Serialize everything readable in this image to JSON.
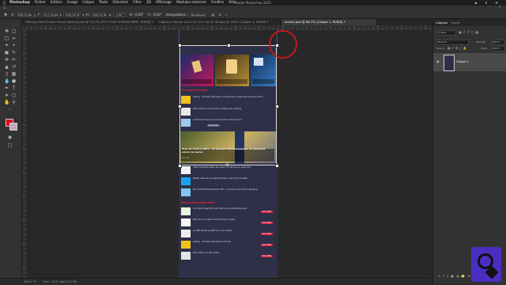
{
  "menubar": {
    "app": "Photoshop",
    "items": [
      "Fichier",
      "Edition",
      "Image",
      "Calque",
      "Texte",
      "Sélection",
      "Filtre",
      "3D",
      "Affichage",
      "Modules externes",
      "Fenêtre",
      "Aide"
    ]
  },
  "window_title": "Adobe Photoshop 2021",
  "options_bar": {
    "x_value": "904,50 px",
    "y_value": "127,00 px",
    "w_value": "100,00 %",
    "h_value": "100,00 %",
    "angle_value": "0,00 °",
    "interpolation_label": "Interpolation :",
    "interpolation_value": "Bicubique"
  },
  "tabs": [
    {
      "label": "Holding Hand Smart Phone Mockup.psd @ 33,3% (PUT YOUR SCREEN HERE, RVB/8) *",
      "active": false
    },
    {
      "label": "Capture d'écran 2021-07-19 à 16.53.58.png @ 100% (Calque 1, RVB/8) *",
      "active": false
    },
    {
      "label": "screen.psd @ 66,7% (Calque 1, RVB/8) *",
      "active": true
    }
  ],
  "panel": {
    "tabs": [
      "Calques",
      "Tracés"
    ],
    "blend_mode": "Normal",
    "opacity_label": "Opacité :",
    "opacity_value": "100 %",
    "lock_label": "Verrou :",
    "fill_label": "Fond :",
    "fill_value": "100 %",
    "layers": [
      {
        "name": "Calque 1",
        "selected": true
      }
    ]
  },
  "status": {
    "zoom": "66,67 %",
    "doc_size": "Doc : 3,52 Mo/3,52 Mo"
  },
  "document": {
    "section1_title": "Derniers articles",
    "articles": [
      "Galaxy : 70 dead high test comment lire le detail des Amazon Prime",
      "Sea divers et un transfert multiple des tuesday",
      "Comment utiliser le nouvel outil de Windows 11"
    ],
    "hero_title": "Tour de France 2021 : 10 dossiers technologiques et comment suivre la course",
    "hero_date": "Il y a 4h",
    "articles2": [
      "Apple présente Apple Pay Later, un service de paiement",
      "Twitter abandonne déjà les Fleets, une fonctionnalité",
      "Microsoft Teams Windows 365 : la solution de cloud computing"
    ],
    "section2_title": "Bons plans high-tech",
    "deals": [
      "Comment regarder Squid Game et le streaming plus",
      "Pack de 2 écouteurs sans fil à prix cassé",
      "Le SSD Samsung 980 Pro à prix réduit",
      "Galaxy : 70 dead high test comment",
      "Echo Show 5 à prix réduit"
    ],
    "deal_badge": "Voir l'offre",
    "pill_label": "Bonus app"
  }
}
